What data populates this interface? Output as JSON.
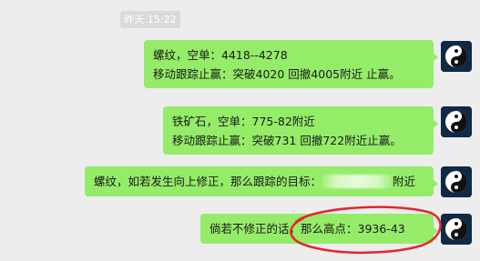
{
  "timestamp": "昨天 15:22",
  "messages": [
    {
      "lines": [
        "螺纹，空单：4418--4278",
        "移动跟踪止赢：突破4020 回撤4005附近 止赢。"
      ]
    },
    {
      "lines": [
        "铁矿石，空单：775-82附近",
        "移动跟踪止赢：突破731 回撤722附近止赢。"
      ]
    },
    {
      "prefix": "螺纹，如若发生向上修正，那么跟踪的目标：",
      "suffix": "附近"
    },
    {
      "text": "倘若不修正的话，那么高点：3936-43"
    }
  ],
  "colors": {
    "bubble": "#95ec69",
    "background": "#ededed",
    "circle_annotation": "#e3262f"
  },
  "icons": {
    "avatar": "yin-yang-icon"
  }
}
